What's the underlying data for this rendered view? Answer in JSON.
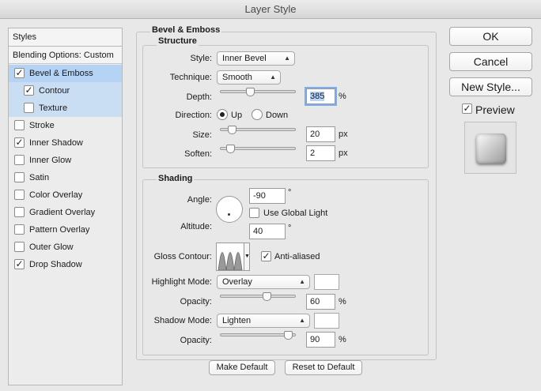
{
  "window": {
    "title": "Layer Style"
  },
  "sidebar": {
    "header": "Styles",
    "blending": "Blending Options: Custom",
    "items": [
      {
        "label": "Bevel & Emboss",
        "checked": true
      },
      {
        "label": "Contour",
        "checked": true
      },
      {
        "label": "Texture",
        "checked": false
      },
      {
        "label": "Stroke",
        "checked": false
      },
      {
        "label": "Inner Shadow",
        "checked": true
      },
      {
        "label": "Inner Glow",
        "checked": false
      },
      {
        "label": "Satin",
        "checked": false
      },
      {
        "label": "Color Overlay",
        "checked": false
      },
      {
        "label": "Gradient Overlay",
        "checked": false
      },
      {
        "label": "Pattern Overlay",
        "checked": false
      },
      {
        "label": "Outer Glow",
        "checked": false
      },
      {
        "label": "Drop Shadow",
        "checked": true
      }
    ]
  },
  "panel": {
    "title": "Bevel & Emboss",
    "structure": {
      "title": "Structure",
      "style_label": "Style:",
      "style_value": "Inner Bevel",
      "technique_label": "Technique:",
      "technique_value": "Smooth",
      "depth_label": "Depth:",
      "depth_value": "385",
      "depth_unit": "%",
      "direction_label": "Direction:",
      "direction_up": "Up",
      "direction_down": "Down",
      "size_label": "Size:",
      "size_value": "20",
      "size_unit": "px",
      "soften_label": "Soften:",
      "soften_value": "2",
      "soften_unit": "px"
    },
    "shading": {
      "title": "Shading",
      "angle_label": "Angle:",
      "angle_value": "-90",
      "angle_unit": "°",
      "global_light_label": "Use Global Light",
      "altitude_label": "Altitude:",
      "altitude_value": "40",
      "altitude_unit": "°",
      "gloss_label": "Gloss Contour:",
      "anti_aliased_label": "Anti-aliased",
      "highlight_mode_label": "Highlight Mode:",
      "highlight_mode_value": "Overlay",
      "highlight_opacity_label": "Opacity:",
      "highlight_opacity_value": "60",
      "highlight_opacity_unit": "%",
      "shadow_mode_label": "Shadow Mode:",
      "shadow_mode_value": "Lighten",
      "shadow_opacity_label": "Opacity:",
      "shadow_opacity_value": "90",
      "shadow_opacity_unit": "%"
    },
    "make_default": "Make Default",
    "reset_default": "Reset to Default"
  },
  "actions": {
    "ok": "OK",
    "cancel": "Cancel",
    "new_style": "New Style...",
    "preview_label": "Preview"
  },
  "colors": {
    "selection": "#b4d3f5",
    "focus_ring": "#7aadf1",
    "highlight_swatch": "#ffffff",
    "shadow_swatch": "#ffffff"
  }
}
